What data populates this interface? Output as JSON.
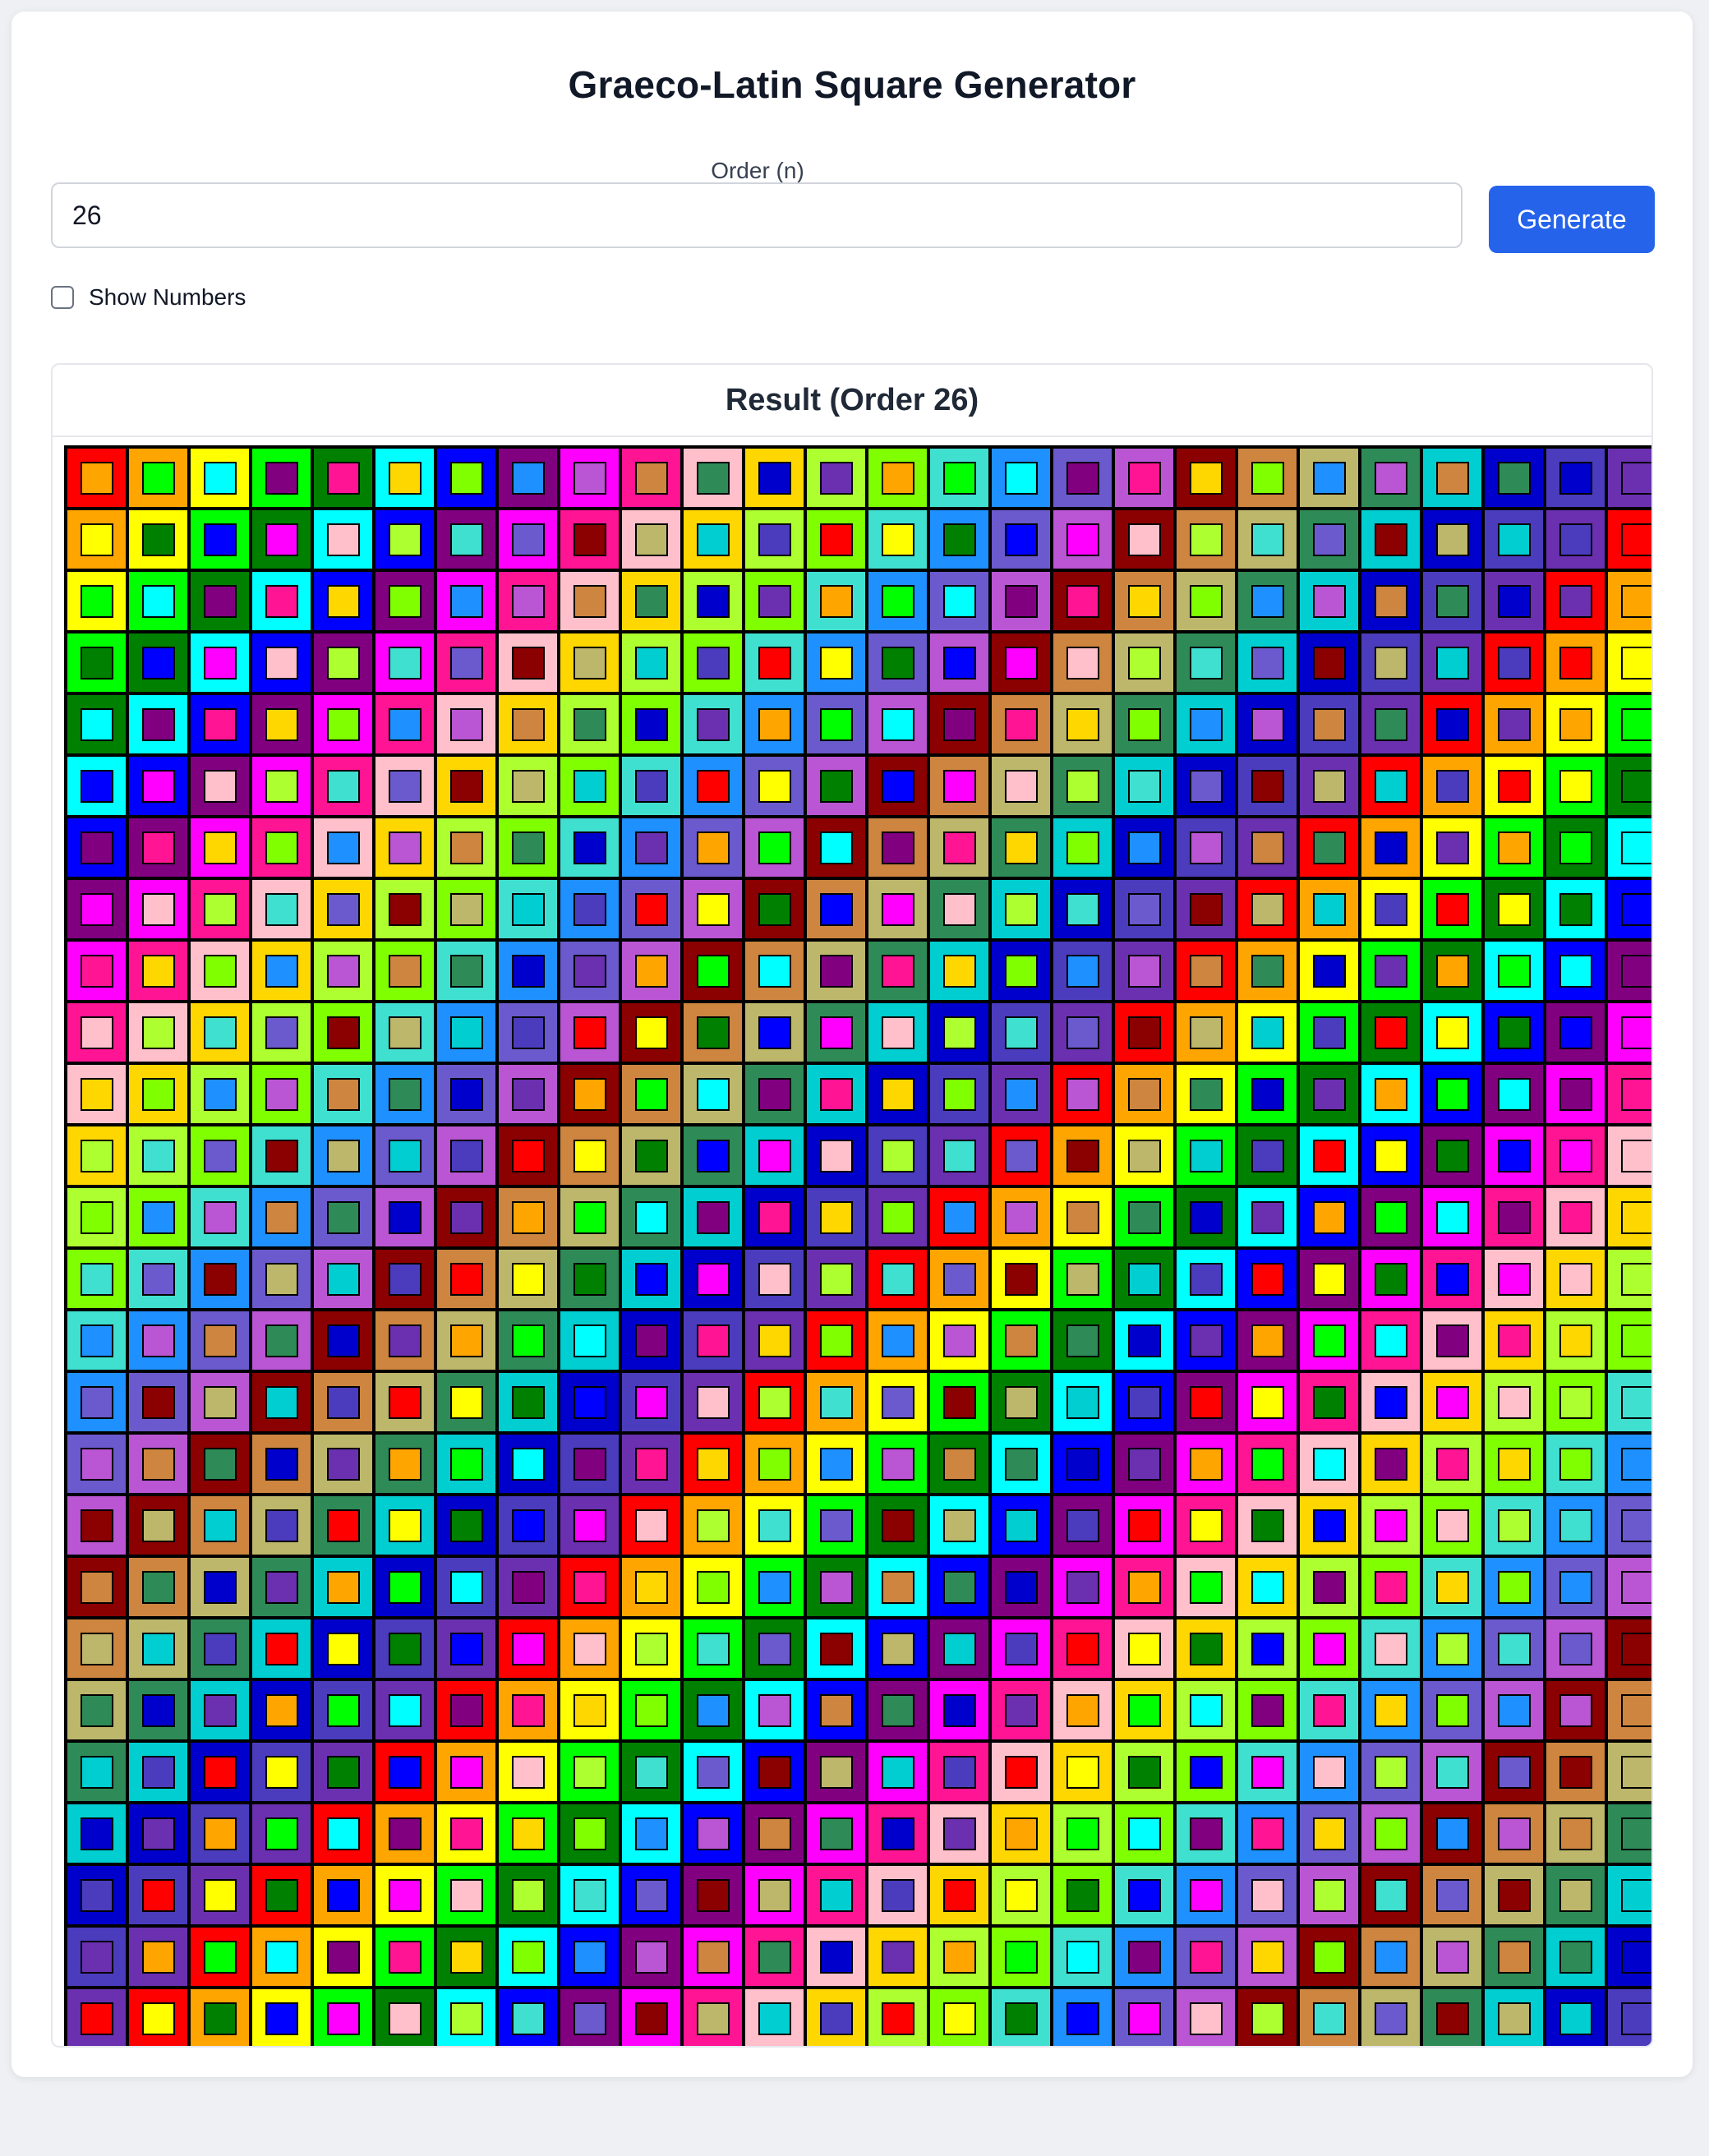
{
  "app": {
    "title": "Graeco-Latin Square Generator"
  },
  "form": {
    "order_label": "Order (n)",
    "order_value": "26",
    "generate_label": "Generate",
    "show_numbers_label": "Show Numbers",
    "show_numbers_checked": false
  },
  "result": {
    "title": "Result (Order 26)",
    "order": 26,
    "palette": [
      "#ff0000",
      "#ffa500",
      "#ffff00",
      "#00ff00",
      "#008000",
      "#00ffff",
      "#0000ff",
      "#800080",
      "#ff00ff",
      "#ff1493",
      "#ffc0cb",
      "#ffd700",
      "#adff2f",
      "#7fff00",
      "#40e0d0",
      "#1e90ff",
      "#6a5acd",
      "#ba55d3",
      "#8b0000",
      "#cd853f",
      "#bdb76b",
      "#2e8b57",
      "#00ced1",
      "#0000cd",
      "#4b3cbe",
      "#6a30b0"
    ],
    "colors": {
      "accent": "#2563eb",
      "border": "#000000",
      "card": "#ffffff",
      "background": "#eef0f3"
    }
  }
}
